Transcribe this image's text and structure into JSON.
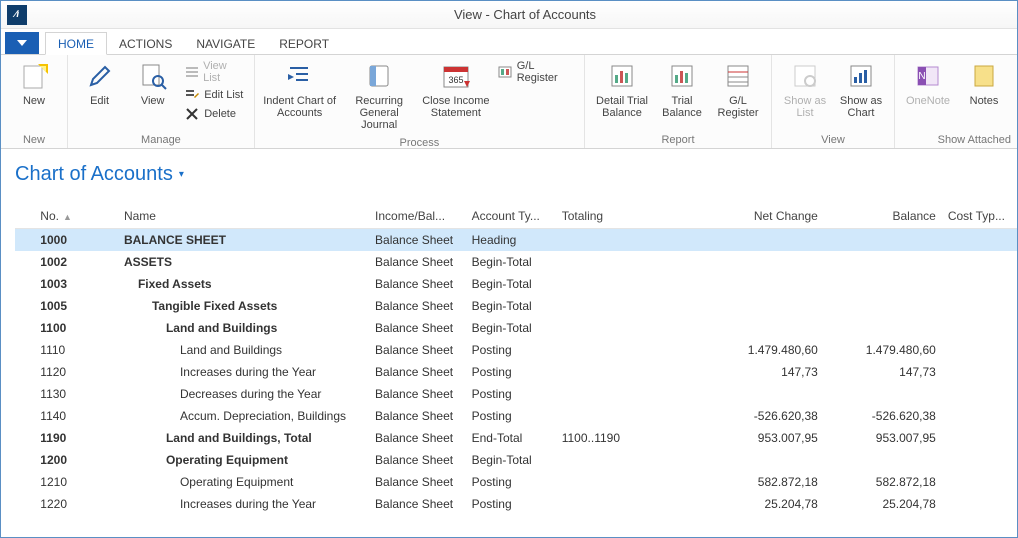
{
  "window": {
    "title": "View - Chart of Accounts"
  },
  "tabs": {
    "home": "HOME",
    "actions": "ACTIONS",
    "navigate": "NAVIGATE",
    "report": "REPORT"
  },
  "ribbon": {
    "new": {
      "label": "New",
      "group": "New"
    },
    "manage": {
      "edit": "Edit",
      "view": "View",
      "view_list": "View List",
      "edit_list": "Edit List",
      "delete": "Delete",
      "group": "Manage"
    },
    "process": {
      "indent": "Indent Chart of Accounts",
      "recurring": "Recurring General Journal",
      "close_income": "Close Income Statement",
      "gl_register_small": "G/L Register",
      "group": "Process"
    },
    "report": {
      "detail_trial": "Detail Trial Balance",
      "trial": "Trial Balance",
      "gl_register": "G/L Register",
      "group": "Report"
    },
    "view": {
      "show_list": "Show as List",
      "show_chart": "Show as Chart",
      "group": "View"
    },
    "attached": {
      "onenote": "OneNote",
      "notes": "Notes",
      "group": "Show Attached"
    }
  },
  "page": {
    "title": "Chart of Accounts"
  },
  "columns": {
    "no": "No.",
    "name": "Name",
    "income": "Income/Bal...",
    "account_type": "Account Ty...",
    "totaling": "Totaling",
    "net_change": "Net Change",
    "balance": "Balance",
    "cost_type": "Cost Typ..."
  },
  "rows": [
    {
      "no": "1000",
      "name": "BALANCE SHEET",
      "indent": 0,
      "bold": true,
      "income": "Balance Sheet",
      "type": "Heading",
      "totaling": "",
      "net": "",
      "bal": "",
      "selected": true
    },
    {
      "no": "1002",
      "name": "ASSETS",
      "indent": 0,
      "bold": true,
      "income": "Balance Sheet",
      "type": "Begin-Total",
      "totaling": "",
      "net": "",
      "bal": ""
    },
    {
      "no": "1003",
      "name": "Fixed Assets",
      "indent": 1,
      "bold": true,
      "income": "Balance Sheet",
      "type": "Begin-Total",
      "totaling": "",
      "net": "",
      "bal": ""
    },
    {
      "no": "1005",
      "name": "Tangible Fixed Assets",
      "indent": 2,
      "bold": true,
      "income": "Balance Sheet",
      "type": "Begin-Total",
      "totaling": "",
      "net": "",
      "bal": ""
    },
    {
      "no": "1100",
      "name": "Land and Buildings",
      "indent": 3,
      "bold": true,
      "income": "Balance Sheet",
      "type": "Begin-Total",
      "totaling": "",
      "net": "",
      "bal": ""
    },
    {
      "no": "1110",
      "name": "Land and Buildings",
      "indent": 4,
      "bold": false,
      "income": "Balance Sheet",
      "type": "Posting",
      "totaling": "",
      "net": "1.479.480,60",
      "bal": "1.479.480,60"
    },
    {
      "no": "1120",
      "name": "Increases during the Year",
      "indent": 4,
      "bold": false,
      "income": "Balance Sheet",
      "type": "Posting",
      "totaling": "",
      "net": "147,73",
      "bal": "147,73"
    },
    {
      "no": "1130",
      "name": "Decreases during the Year",
      "indent": 4,
      "bold": false,
      "income": "Balance Sheet",
      "type": "Posting",
      "totaling": "",
      "net": "",
      "bal": ""
    },
    {
      "no": "1140",
      "name": "Accum. Depreciation, Buildings",
      "indent": 4,
      "bold": false,
      "income": "Balance Sheet",
      "type": "Posting",
      "totaling": "",
      "net": "-526.620,38",
      "bal": "-526.620,38"
    },
    {
      "no": "1190",
      "name": "Land and Buildings, Total",
      "indent": 3,
      "bold": true,
      "income": "Balance Sheet",
      "type": "End-Total",
      "totaling": "1100..1190",
      "net": "953.007,95",
      "bal": "953.007,95"
    },
    {
      "no": "1200",
      "name": "Operating Equipment",
      "indent": 3,
      "bold": true,
      "income": "Balance Sheet",
      "type": "Begin-Total",
      "totaling": "",
      "net": "",
      "bal": ""
    },
    {
      "no": "1210",
      "name": "Operating Equipment",
      "indent": 4,
      "bold": false,
      "income": "Balance Sheet",
      "type": "Posting",
      "totaling": "",
      "net": "582.872,18",
      "bal": "582.872,18"
    },
    {
      "no": "1220",
      "name": "Increases during the Year",
      "indent": 4,
      "bold": false,
      "income": "Balance Sheet",
      "type": "Posting",
      "totaling": "",
      "net": "25.204,78",
      "bal": "25.204,78"
    }
  ]
}
